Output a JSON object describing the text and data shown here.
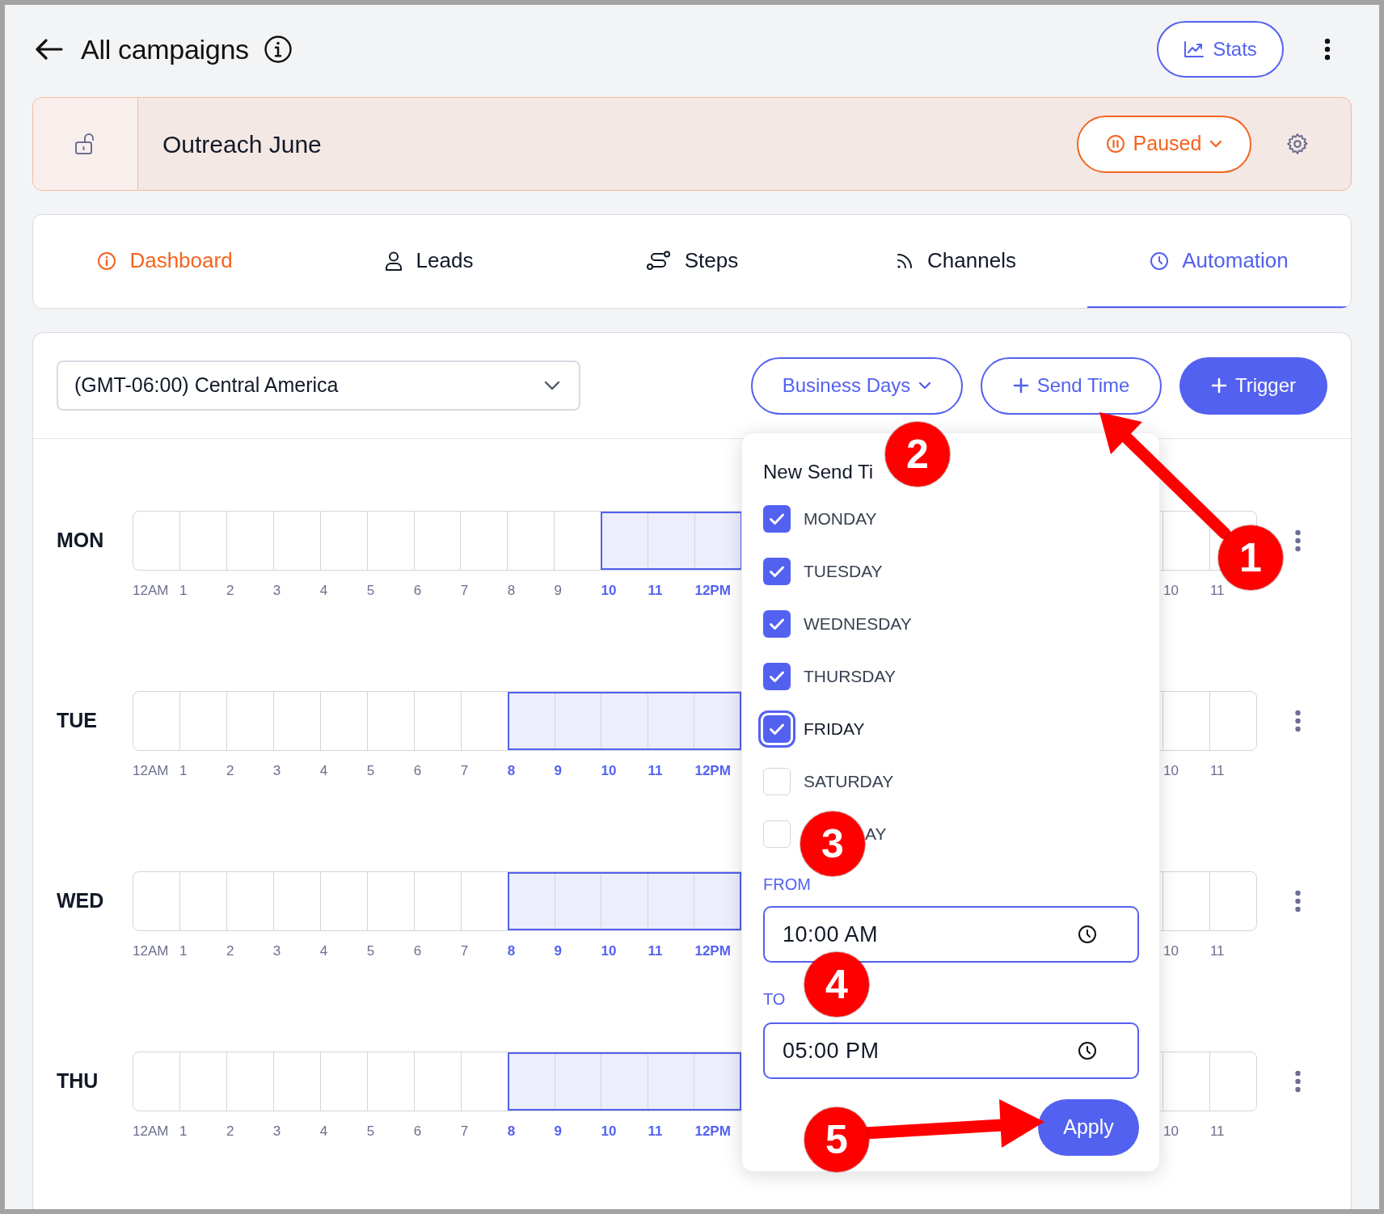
{
  "header": {
    "title": "All campaigns",
    "stats_button": "Stats"
  },
  "campaign": {
    "name": "Outreach June",
    "status": {
      "label": "Paused",
      "kind": "paused"
    }
  },
  "tabs": [
    {
      "label": "Dashboard",
      "kind": "info",
      "selected": false,
      "alert": true
    },
    {
      "label": "Leads",
      "kind": "person",
      "selected": false,
      "alert": false
    },
    {
      "label": "Steps",
      "kind": "steps",
      "selected": false,
      "alert": false
    },
    {
      "label": "Channels",
      "kind": "rss",
      "selected": false,
      "alert": false
    },
    {
      "label": "Automation",
      "kind": "clock",
      "selected": true,
      "alert": false
    }
  ],
  "schedule": {
    "timezone": "(GMT-06:00) Central America",
    "buttons": [
      {
        "label": "Business Days",
        "kind": "dropdown"
      },
      {
        "label": "Send Time",
        "kind": "add"
      },
      {
        "label": "Trigger",
        "kind": "add_filled"
      }
    ],
    "days": [
      {
        "label": "MON",
        "hours_start": [
          {
            "text": "12AM",
            "highlighted": false
          },
          {
            "text": "1",
            "highlighted": false
          },
          {
            "text": "2",
            "highlighted": false
          },
          {
            "text": "3",
            "highlighted": false
          },
          {
            "text": "4",
            "highlighted": false
          },
          {
            "text": "5",
            "highlighted": false
          },
          {
            "text": "6",
            "highlighted": false
          },
          {
            "text": "7",
            "highlighted": false
          },
          {
            "text": "8",
            "highlighted": false
          },
          {
            "text": "9",
            "highlighted": false
          },
          {
            "text": "10",
            "highlighted": true
          },
          {
            "text": "11",
            "highlighted": true
          },
          {
            "text": "12PM",
            "highlighted": true
          }
        ],
        "hours_end": [
          {
            "text": "10",
            "highlighted": false
          },
          {
            "text": "11",
            "highlighted": false
          }
        ]
      },
      {
        "label": "TUE",
        "hours_start": [
          {
            "text": "12AM",
            "highlighted": false
          },
          {
            "text": "1",
            "highlighted": false
          },
          {
            "text": "2",
            "highlighted": false
          },
          {
            "text": "3",
            "highlighted": false
          },
          {
            "text": "4",
            "highlighted": false
          },
          {
            "text": "5",
            "highlighted": false
          },
          {
            "text": "6",
            "highlighted": false
          },
          {
            "text": "7",
            "highlighted": false
          },
          {
            "text": "8",
            "highlighted": true
          },
          {
            "text": "9",
            "highlighted": true
          },
          {
            "text": "10",
            "highlighted": true
          },
          {
            "text": "11",
            "highlighted": true
          },
          {
            "text": "12PM",
            "highlighted": true
          }
        ],
        "hours_end": [
          {
            "text": "10",
            "highlighted": false
          },
          {
            "text": "11",
            "highlighted": false
          }
        ]
      },
      {
        "label": "WED",
        "hours_start": [
          {
            "text": "12AM",
            "highlighted": false
          },
          {
            "text": "1",
            "highlighted": false
          },
          {
            "text": "2",
            "highlighted": false
          },
          {
            "text": "3",
            "highlighted": false
          },
          {
            "text": "4",
            "highlighted": false
          },
          {
            "text": "5",
            "highlighted": false
          },
          {
            "text": "6",
            "highlighted": false
          },
          {
            "text": "7",
            "highlighted": false
          },
          {
            "text": "8",
            "highlighted": true
          },
          {
            "text": "9",
            "highlighted": true
          },
          {
            "text": "10",
            "highlighted": true
          },
          {
            "text": "11",
            "highlighted": true
          },
          {
            "text": "12PM",
            "highlighted": true
          }
        ],
        "hours_end": [
          {
            "text": "10",
            "highlighted": false
          },
          {
            "text": "11",
            "highlighted": false
          }
        ]
      },
      {
        "label": "THU",
        "hours_start": [
          {
            "text": "12AM",
            "highlighted": false
          },
          {
            "text": "1",
            "highlighted": false
          },
          {
            "text": "2",
            "highlighted": false
          },
          {
            "text": "3",
            "highlighted": false
          },
          {
            "text": "4",
            "highlighted": false
          },
          {
            "text": "5",
            "highlighted": false
          },
          {
            "text": "6",
            "highlighted": false
          },
          {
            "text": "7",
            "highlighted": false
          },
          {
            "text": "8",
            "highlighted": true
          },
          {
            "text": "9",
            "highlighted": true
          },
          {
            "text": "10",
            "highlighted": true
          },
          {
            "text": "11",
            "highlighted": true
          },
          {
            "text": "12PM",
            "highlighted": true
          }
        ],
        "hours_end": [
          {
            "text": "10",
            "highlighted": false
          },
          {
            "text": "11",
            "highlighted": false
          }
        ]
      }
    ]
  },
  "popup": {
    "title": "New Send Ti",
    "days": [
      {
        "label": "MONDAY",
        "checked": true,
        "focused": false
      },
      {
        "label": "TUESDAY",
        "checked": true,
        "focused": false
      },
      {
        "label": "WEDNESDAY",
        "checked": true,
        "focused": false
      },
      {
        "label": "THURSDAY",
        "checked": true,
        "focused": false
      },
      {
        "label": "FRIDAY",
        "checked": true,
        "focused": true
      },
      {
        "label": "SATURDAY",
        "checked": false,
        "focused": false
      },
      {
        "label": "AY",
        "checked": false,
        "focused": false
      }
    ],
    "from": {
      "label": "FROM",
      "value": "10:00 AM"
    },
    "to": {
      "label": "TO",
      "value": "05:00 PM"
    },
    "apply": "Apply"
  },
  "annotations": [
    {
      "number": "1"
    },
    {
      "number": "2"
    },
    {
      "number": "3"
    },
    {
      "number": "4"
    },
    {
      "number": "5"
    }
  ]
}
